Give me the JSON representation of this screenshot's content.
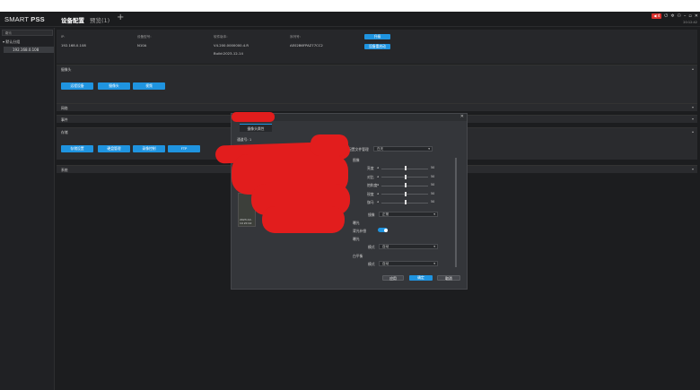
{
  "app": {
    "logo_main": "SMART ",
    "logo_bold": "PSS",
    "tabs": [
      "设备配置",
      "预览(1)"
    ],
    "add_tab": "+",
    "badge": "4",
    "clock": "20:12:42"
  },
  "sidebar": {
    "search_placeholder": "搜索",
    "group": "▾ 默认分组",
    "device": "192.168.0.108"
  },
  "info": {
    "ip_label": "IP:",
    "ip_value": "192.168.0.108",
    "model_label": "设备型号:",
    "model_value": "N10A",
    "fw_label": "软件版本:",
    "fw_value": "V4.200.0000000.4.R",
    "fw_build": "Build:2023-12-14",
    "sn_label": "序列号:",
    "sn_value": "AE02B6FPAZ77CC2",
    "btn_upgrade": "升级",
    "btn_reboot": "设备重启动"
  },
  "panels": {
    "camera": "摄像头",
    "camera_buttons": [
      "远程设备",
      "摄像头",
      "视频"
    ],
    "network": "网络",
    "event": "事件",
    "storage": "存储",
    "storage_buttons": [
      "存储设置",
      "硬盘管理",
      "录像控制",
      "FTP"
    ],
    "system": "系统"
  },
  "dialog": {
    "tab": "摄像头属性",
    "channel_label": "通道号:",
    "channel_value": "1",
    "config_label": "配置文件管理",
    "config_value": "白天",
    "image_section": "图像",
    "sliders": [
      {
        "label": "亮度",
        "value": 50
      },
      {
        "label": "对比",
        "value": 50
      },
      {
        "label": "饱和度",
        "value": 50
      },
      {
        "label": "锐度",
        "value": 50
      },
      {
        "label": "伽马",
        "value": 50
      }
    ],
    "mirror_label": "镜像",
    "mirror_value": "正常",
    "exposure_section": "曝光",
    "backlight_label": "背光补偿",
    "backlight_on": true,
    "wb_section": "曝光",
    "mode_label": "模式",
    "mode_value": "自动",
    "dn_section": "白平衡",
    "mode2_label": "模式",
    "mode2_value": "自动",
    "preview_time": "2023-12-14 20:12",
    "btn_apply": "应用",
    "btn_ok": "确定",
    "btn_cancel": "取消"
  },
  "colors": {
    "accent": "#1f94e0",
    "background": "#1c1d1f",
    "redaction": "#e21d1d"
  }
}
